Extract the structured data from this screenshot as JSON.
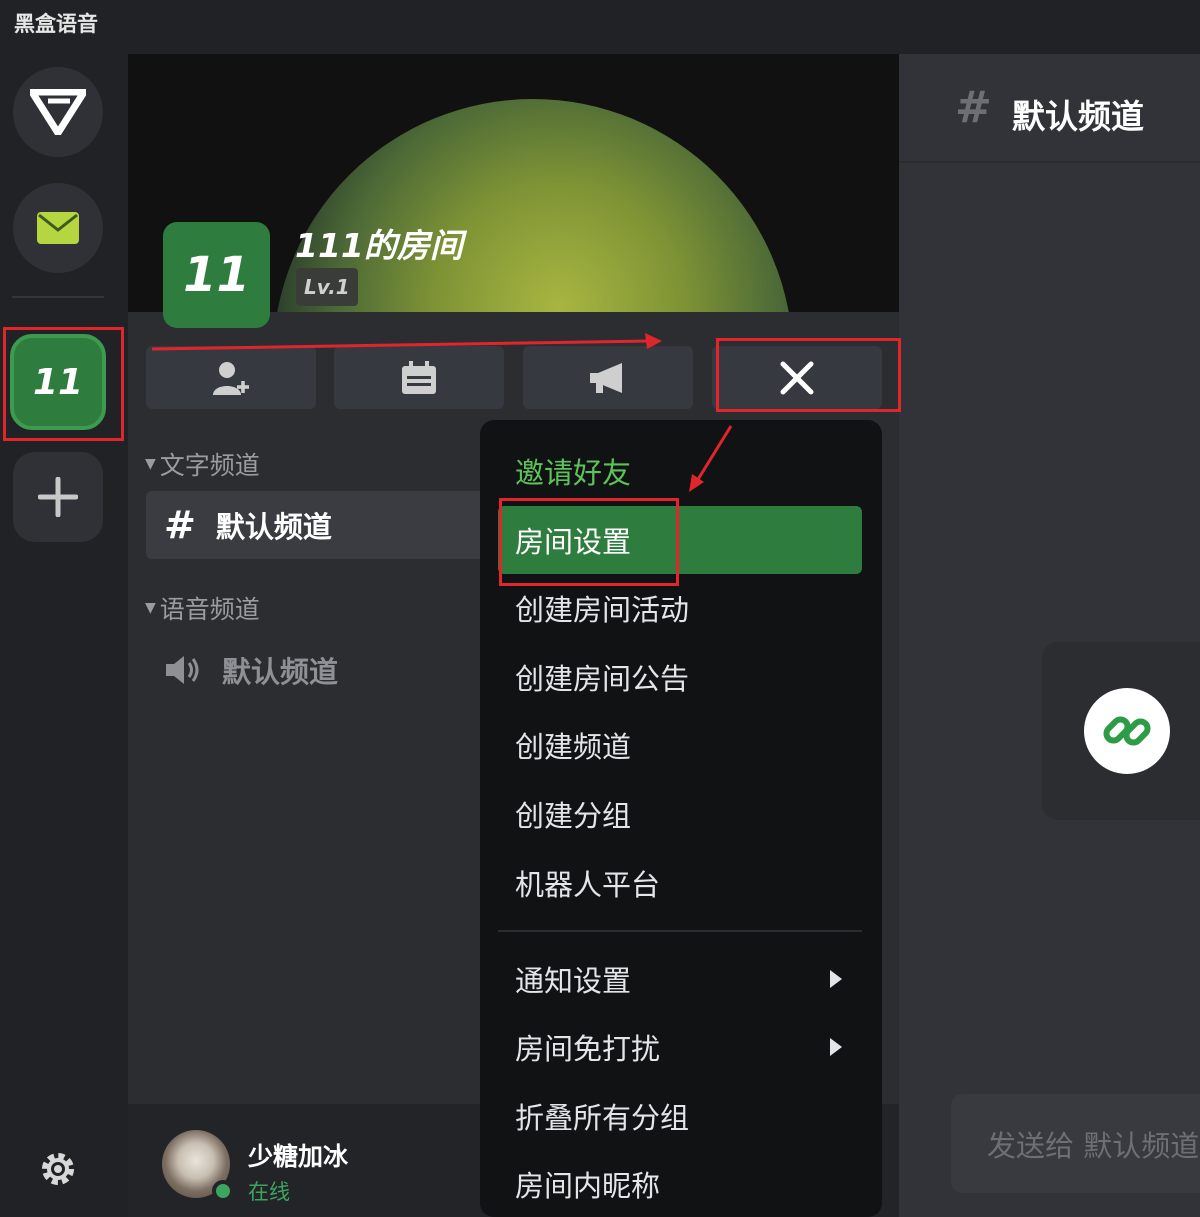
{
  "app": {
    "title": "黑盒语音"
  },
  "server_rail": {
    "active_server_label": "11"
  },
  "room": {
    "icon_label": "11",
    "name": "111的房间",
    "level": "Lv.1"
  },
  "toolbar": {
    "buttons": [
      {
        "icon": "add-user-icon"
      },
      {
        "icon": "calendar-icon"
      },
      {
        "icon": "megaphone-icon"
      },
      {
        "icon": "close-icon"
      }
    ]
  },
  "channels": {
    "text_section": "文字频道",
    "text_items": [
      {
        "label": "默认频道",
        "selected": true
      }
    ],
    "voice_section": "语音频道",
    "voice_items": [
      {
        "label": "默认频道"
      }
    ]
  },
  "user": {
    "name": "少糖加冰",
    "status": "在线"
  },
  "main": {
    "channel_title": "默认频道",
    "composer_placeholder": "发送给 默认频道"
  },
  "menu": {
    "items": [
      {
        "label": "邀请好友"
      },
      {
        "label": "房间设置",
        "active": true
      },
      {
        "label": "创建房间活动"
      },
      {
        "label": "创建房间公告"
      },
      {
        "label": "创建频道"
      },
      {
        "label": "创建分组"
      },
      {
        "label": "机器人平台"
      },
      {
        "label": "通知设置",
        "submenu": true
      },
      {
        "label": "房间免打扰",
        "submenu": true
      },
      {
        "label": "折叠所有分组"
      },
      {
        "label": "房间内昵称"
      }
    ]
  },
  "colors": {
    "accent_green": "#2f7d3e",
    "online_green": "#3ba55d",
    "highlight_red": "#e0262b"
  }
}
